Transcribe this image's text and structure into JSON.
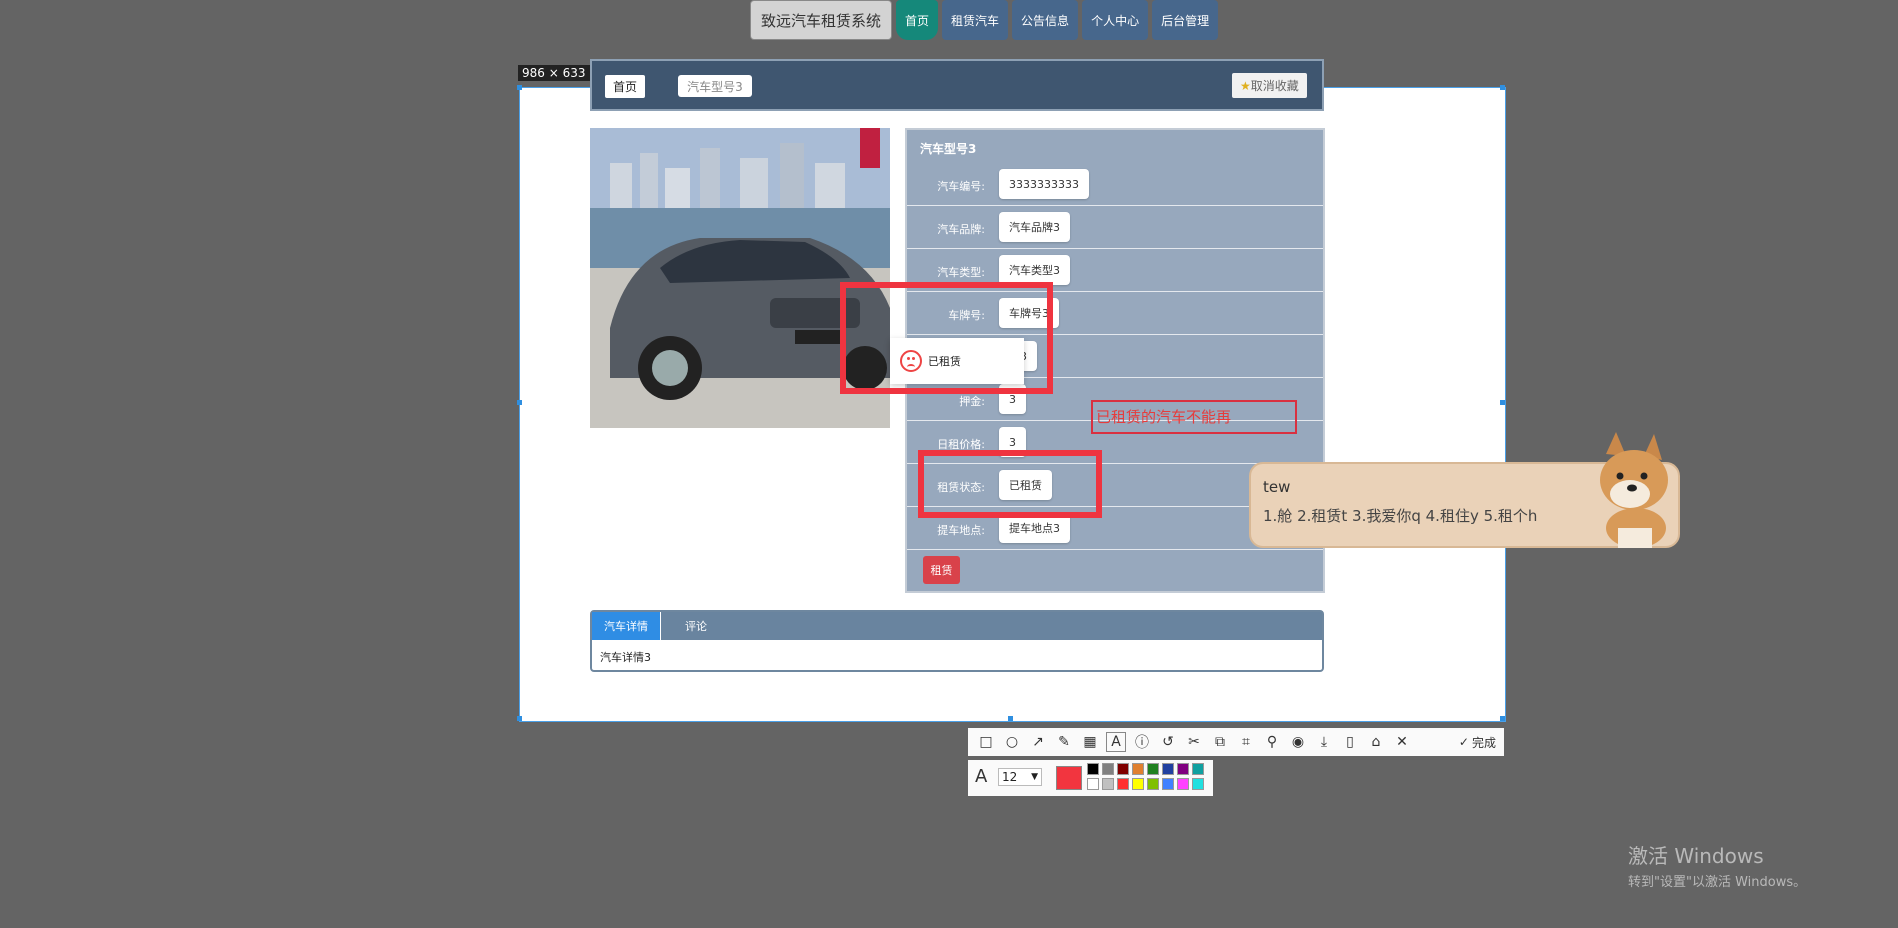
{
  "topnav": {
    "brand": "致远汽车租赁系统",
    "items": [
      "首页",
      "租赁汽车",
      "公告信息",
      "个人中心",
      "后台管理"
    ]
  },
  "selection": {
    "dimensions": "986 × 633"
  },
  "breadcrumb": {
    "home": "首页",
    "model": "汽车型号3"
  },
  "cancel_favorite": "取消收藏",
  "car": {
    "title": "汽车型号3",
    "fields": [
      {
        "label": "汽车编号:",
        "value": "3333333333"
      },
      {
        "label": "汽车品牌:",
        "value": "汽车品牌3"
      },
      {
        "label": "汽车类型:",
        "value": "汽车类型3"
      },
      {
        "label": "车牌号:",
        "value": "车牌号3"
      },
      {
        "label": "",
        "value": "色3"
      },
      {
        "label": "押金:",
        "value": "3"
      },
      {
        "label": "日租价格:",
        "value": "3"
      },
      {
        "label": "租赁状态:",
        "value": "已租赁"
      },
      {
        "label": "提车地点:",
        "value": "提车地点3"
      }
    ],
    "rent_button": "租赁"
  },
  "toast": {
    "message": "已租赁"
  },
  "annotation_text": "已租赁的汽车不能再",
  "tabs": {
    "details": "汽车详情",
    "comments": "评论",
    "body": "汽车详情3"
  },
  "ime": {
    "input": "tew",
    "candidates": "1.舱  2.租赁t  3.我爱你q  4.租住y  5.租个h"
  },
  "toolbar": {
    "done": "完成",
    "font_size": "12",
    "active_color": "#f2353f",
    "palette": [
      "#000000",
      "#808080",
      "#800000",
      "#e08030",
      "#208020",
      "#2040a0",
      "#800080",
      "#10a0a0",
      "#ffffff",
      "#c0c0c0",
      "#ff3030",
      "#ffff00",
      "#80c000",
      "#4080ff",
      "#ff40ff",
      "#20e0e0"
    ]
  },
  "windows_activation": {
    "line1": "激活 Windows",
    "line2": "转到\"设置\"以激活 Windows。"
  }
}
